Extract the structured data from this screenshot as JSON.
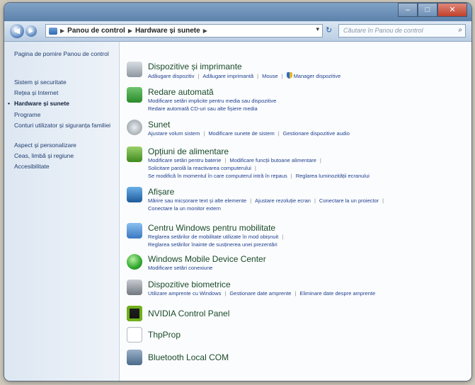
{
  "window": {
    "caption": {
      "minimize": "–",
      "maximize": "□",
      "close": "✕"
    }
  },
  "nav": {
    "back": "◀",
    "forward": "▶",
    "breadcrumb": [
      "Panou de control",
      "Hardware și sunete"
    ],
    "search_placeholder": "Căutare în Panou de control"
  },
  "sidebar": {
    "items": [
      {
        "label": "Pagina de pornire Panou de control"
      },
      {
        "label": "Sistem și securitate"
      },
      {
        "label": "Rețea și Internet"
      },
      {
        "label": "Hardware și sunete"
      },
      {
        "label": "Programe"
      },
      {
        "label": "Conturi utilizator și siguranța familiei"
      },
      {
        "label": "Aspect și personalizare"
      },
      {
        "label": "Ceas, limbă și regiune"
      },
      {
        "label": "Accesibilitate"
      }
    ]
  },
  "categories": [
    {
      "title": "Dispozitive și imprimante",
      "lines": [
        [
          "Adăugare dispozitiv",
          "Adăugare imprimantă",
          "Mouse",
          "Manager dispozitive"
        ]
      ]
    },
    {
      "title": "Redare automată",
      "lines": [
        [
          "Modificare setări implicite pentru media sau dispozitive"
        ],
        [
          "Redare automată CD-uri sau alte fișiere media"
        ]
      ]
    },
    {
      "title": "Sunet",
      "lines": [
        [
          "Ajustare volum sistem",
          "Modificare sunete de sistem",
          "Gestionare dispozitive audio"
        ]
      ]
    },
    {
      "title": "Opțiuni de alimentare",
      "lines": [
        [
          "Modificare setări pentru baterie",
          "Modificare funcții butoane alimentare"
        ],
        [
          "Solicitare parolă la reactivarea computerului"
        ],
        [
          "Se modifică în momentul în care computerul intră în repaus",
          "Reglarea luminozității ecranului"
        ]
      ]
    },
    {
      "title": "Afișare",
      "lines": [
        [
          "Mărire sau micșorare text și alte elemente",
          "Ajustare rezoluție ecran",
          "Conectare la un proiector"
        ],
        [
          "Conectare la un monitor extern"
        ]
      ]
    },
    {
      "title": "Centru Windows pentru mobilitate",
      "lines": [
        [
          "Reglarea setărilor de mobilitate utilizate în mod obișnuit"
        ],
        [
          "Reglarea setărilor înainte de susținerea unei prezentări"
        ]
      ]
    },
    {
      "title": "Windows Mobile Device Center",
      "lines": [
        [
          "Modificare setări conexiune"
        ]
      ]
    },
    {
      "title": "Dispozitive biometrice",
      "lines": [
        [
          "Utilizare amprente cu Windows",
          "Gestionare date amprente",
          "Eliminare date despre amprente"
        ]
      ]
    },
    {
      "title": "NVIDIA Control Panel",
      "lines": []
    },
    {
      "title": "ThpProp",
      "lines": []
    },
    {
      "title": "Bluetooth Local COM",
      "lines": []
    }
  ]
}
